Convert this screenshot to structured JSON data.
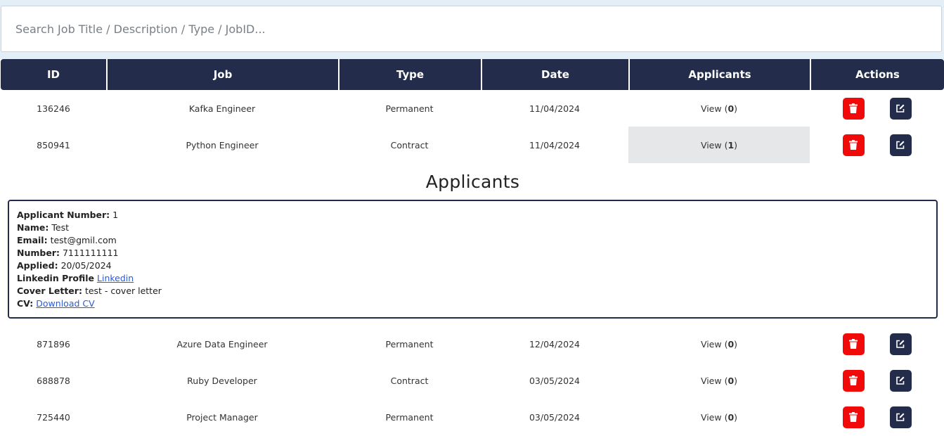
{
  "search": {
    "placeholder": "Search Job Title / Description / Type / JobID..."
  },
  "table": {
    "headers": [
      "ID",
      "Job",
      "Type",
      "Date",
      "Applicants",
      "Actions"
    ],
    "view_label": "View",
    "rows": [
      {
        "id": "136246",
        "job": "Kafka Engineer",
        "type": "Permanent",
        "date": "11/04/2024",
        "applicants": "0"
      },
      {
        "id": "850941",
        "job": "Python Engineer",
        "type": "Contract",
        "date": "11/04/2024",
        "applicants": "1"
      },
      {
        "id": "871896",
        "job": "Azure Data Engineer",
        "type": "Permanent",
        "date": "12/04/2024",
        "applicants": "0"
      },
      {
        "id": "688878",
        "job": "Ruby Developer",
        "type": "Contract",
        "date": "03/05/2024",
        "applicants": "0"
      },
      {
        "id": "725440",
        "job": "Project Manager",
        "type": "Permanent",
        "date": "03/05/2024",
        "applicants": "0"
      }
    ]
  },
  "applicants_panel": {
    "heading": "Applicants",
    "applicant": {
      "number_label": "Applicant Number:",
      "number": "1",
      "name_label": "Name:",
      "name": "Test",
      "email_label": "Email:",
      "email": "test@gmil.com",
      "phone_label": "Number:",
      "phone": "7111111111",
      "applied_label": "Applied:",
      "applied": "20/05/2024",
      "linkedin_label": "Linkedin Profile",
      "linkedin_link": "Linkedin",
      "cover_label": "Cover Letter:",
      "cover": "test - cover letter",
      "cv_label": "CV:",
      "cv_link": "Download CV"
    }
  },
  "icons": {
    "delete": "trash-icon",
    "edit": "edit-icon"
  },
  "colors": {
    "header_bg": "#232d4b",
    "delete_btn": "#f00a0a",
    "edit_btn": "#232d4b",
    "link": "#2a5ad8",
    "highlight": "#e6e7e9"
  }
}
